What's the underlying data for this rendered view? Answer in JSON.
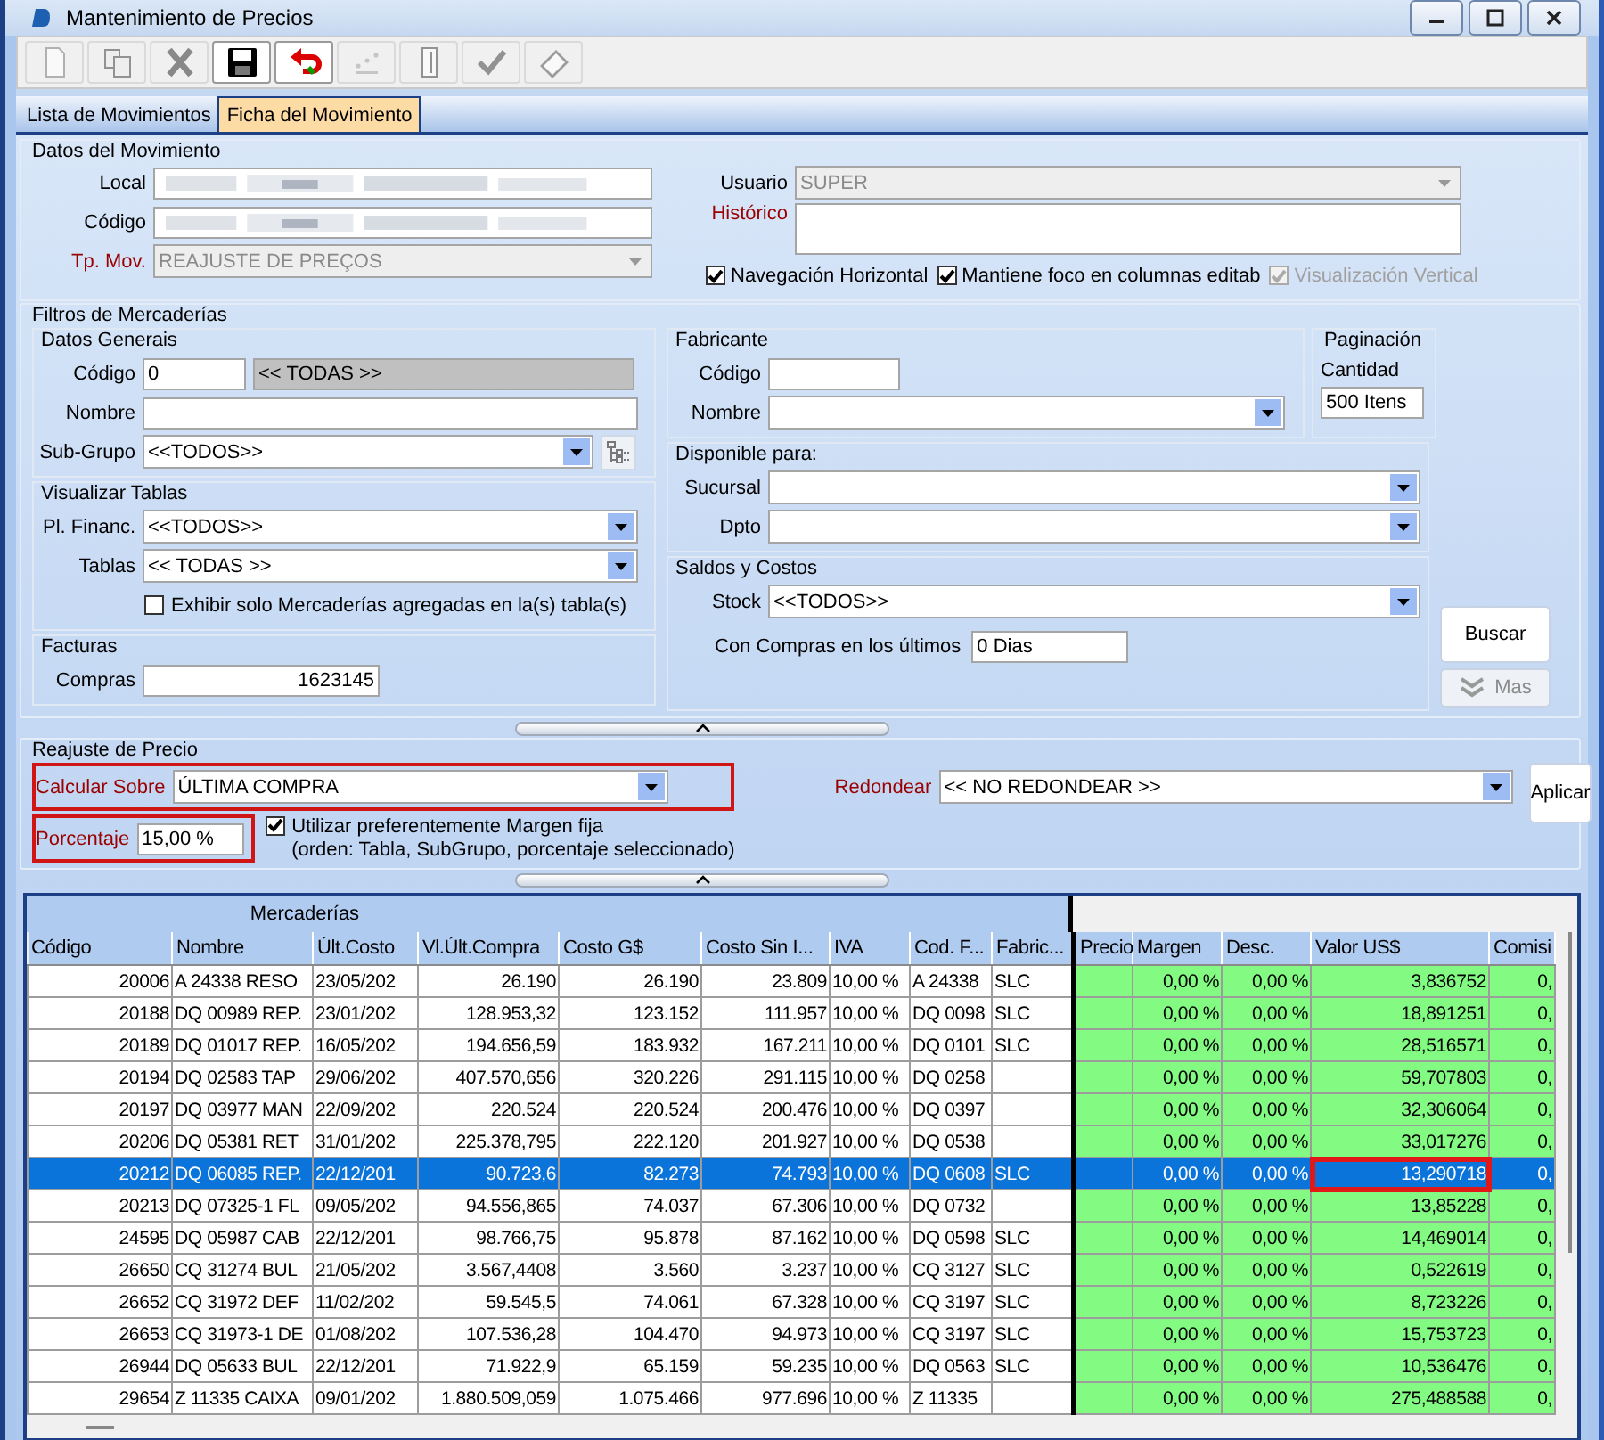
{
  "window": {
    "title": "Mantenimiento de Precios"
  },
  "toolbar": [
    {
      "disabled": true
    },
    {
      "disabled": true
    },
    {
      "disabled": true
    },
    {
      "disabled": false
    },
    {
      "disabled": false
    },
    {
      "disabled": true
    },
    {
      "disabled": true
    },
    {
      "disabled": true
    },
    {
      "disabled": true
    }
  ],
  "tabs": [
    {
      "label": "Lista de Movimientos",
      "selected": false
    },
    {
      "label": "Ficha del Movimiento",
      "selected": true
    }
  ],
  "movimiento": {
    "title": "Datos del Movimiento",
    "local": {
      "label": "Local",
      "required": false,
      "redacted": true
    },
    "codigo": {
      "label": "Código",
      "required": false,
      "redacted": true
    },
    "tp_mov": {
      "label": "Tp. Mov.",
      "value": "REAJUSTE DE PREÇOS",
      "required": true,
      "disabled": true
    },
    "usuario": {
      "label": "Usuario",
      "value": "SUPER",
      "required": false,
      "disabled": true
    },
    "historico": {
      "label": "Histórico",
      "required": true
    },
    "options": [
      {
        "label": "Navegación Horizontal",
        "checked": true,
        "disabled": false
      },
      {
        "label": "Mantiene foco en columnas editab",
        "checked": true,
        "disabled": false
      },
      {
        "label": "Visualización Vertical",
        "checked": true,
        "disabled": true
      }
    ]
  },
  "filtros": {
    "title": "Filtros de Mercaderías",
    "datos_generales": {
      "title": "Datos Generais",
      "codigo": {
        "label": "Código",
        "value": "0",
        "description": "<< TODAS >>"
      },
      "nombre": {
        "label": "Nombre"
      },
      "sub_grupo": {
        "label": "Sub-Grupo",
        "value": "<<TODOS>>"
      }
    },
    "visualizar_tablas": {
      "title": "Visualizar Tablas",
      "pl_financ": {
        "label": "Pl. Financ.",
        "value": "<<TODOS>>"
      },
      "tablas": {
        "label": "Tablas",
        "value": "<< TODAS >>"
      },
      "solo_agregadas": {
        "label": "Exhibir solo Mercaderías agregadas en la(s) tabla(s)",
        "checked": false
      }
    },
    "facturas": {
      "title": "Facturas",
      "compras": {
        "label": "Compras",
        "value": "1623145"
      }
    },
    "fabricante": {
      "title": "Fabricante",
      "codigo": {
        "label": "Código"
      },
      "nombre": {
        "label": "Nombre"
      }
    },
    "paginacion": {
      "title": "Paginación",
      "cantidad": {
        "label": "Cantidad",
        "value": "500 Itens"
      }
    },
    "disponible": {
      "title": "Disponible para:",
      "sucursal": {
        "label": "Sucursal"
      },
      "dpto": {
        "label": "Dpto"
      }
    },
    "saldos": {
      "title": "Saldos y Costos",
      "stock": {
        "label": "Stock",
        "value": "<<TODOS>>"
      },
      "con_compras": {
        "label": "Con Compras en los últimos",
        "value": "0 Dias"
      }
    },
    "buttons": [
      {
        "label": "Buscar",
        "disabled": false
      },
      {
        "label": "Mas",
        "disabled": true
      }
    ]
  },
  "reajuste": {
    "title": "Reajuste de Precio",
    "calcular_sobre": {
      "label": "Calcular Sobre",
      "value": "ÚLTIMA COMPRA",
      "required": true,
      "highlighted": true
    },
    "porcentaje": {
      "label": "Porcentaje",
      "value": "15,00 %",
      "required": true,
      "highlighted": true
    },
    "margen_fija": {
      "lines": [
        "Utilizar preferentemente Margen fija",
        "(orden: Tabla, SubGrupo, porcentaje seleccionado)"
      ],
      "checked": true
    },
    "redondear": {
      "label": "Redondear",
      "value": "<< NO REDONDEAR >>",
      "required": true,
      "highlighted": false
    },
    "aplicar": {
      "label": "Aplicar"
    }
  },
  "grid": {
    "title": "Mercaderías",
    "columns": [
      "Código",
      "Nombre",
      "Últ.Costo",
      "Vl.Últ.Compra",
      "Costo G$",
      "Costo Sin I...",
      "IVA",
      "Cod. F...",
      "Fabric...",
      "Precio",
      "Margen",
      "Desc.",
      "Valor US$",
      "Comisi"
    ],
    "rows": [
      {
        "codigo": "20006",
        "nombre": "A 24338 RESO",
        "ult_costo": "23/05/202",
        "vl_ult_compra": "26.190",
        "costo_gs": "26.190",
        "costo_sin_iva": "23.809",
        "iva": "10,00 %",
        "cod_fabricante": "A 24338",
        "fabricante": "SLC",
        "margen": "0,00 %",
        "desc": "0,00 %",
        "valor_us": "3,836752",
        "comision": "0,",
        "selected": false,
        "marked": false
      },
      {
        "codigo": "20188",
        "nombre": "DQ 00989 REP.",
        "ult_costo": "23/01/202",
        "vl_ult_compra": "128.953,32",
        "costo_gs": "123.152",
        "costo_sin_iva": "111.957",
        "iva": "10,00 %",
        "cod_fabricante": "DQ 0098",
        "fabricante": "SLC",
        "margen": "0,00 %",
        "desc": "0,00 %",
        "valor_us": "18,891251",
        "comision": "0,",
        "selected": false,
        "marked": false
      },
      {
        "codigo": "20189",
        "nombre": "DQ 01017 REP.",
        "ult_costo": "16/05/202",
        "vl_ult_compra": "194.656,59",
        "costo_gs": "183.932",
        "costo_sin_iva": "167.211",
        "iva": "10,00 %",
        "cod_fabricante": "DQ 0101",
        "fabricante": "SLC",
        "margen": "0,00 %",
        "desc": "0,00 %",
        "valor_us": "28,516571",
        "comision": "0,",
        "selected": false,
        "marked": false
      },
      {
        "codigo": "20194",
        "nombre": "DQ 02583 TAP",
        "ult_costo": "29/06/202",
        "vl_ult_compra": "407.570,656",
        "costo_gs": "320.226",
        "costo_sin_iva": "291.115",
        "iva": "10,00 %",
        "cod_fabricante": "DQ 0258",
        "margen": "0,00 %",
        "desc": "0,00 %",
        "valor_us": "59,707803",
        "comision": "0,",
        "selected": false,
        "marked": false
      },
      {
        "codigo": "20197",
        "nombre": "DQ 03977 MAN",
        "ult_costo": "22/09/202",
        "vl_ult_compra": "220.524",
        "costo_gs": "220.524",
        "costo_sin_iva": "200.476",
        "iva": "10,00 %",
        "cod_fabricante": "DQ 0397",
        "margen": "0,00 %",
        "desc": "0,00 %",
        "valor_us": "32,306064",
        "comision": "0,",
        "selected": false,
        "marked": false
      },
      {
        "codigo": "20206",
        "nombre": "DQ 05381 RET",
        "ult_costo": "31/01/202",
        "vl_ult_compra": "225.378,795",
        "costo_gs": "222.120",
        "costo_sin_iva": "201.927",
        "iva": "10,00 %",
        "cod_fabricante": "DQ 0538",
        "margen": "0,00 %",
        "desc": "0,00 %",
        "valor_us": "33,017276",
        "comision": "0,",
        "selected": false,
        "marked": false
      },
      {
        "codigo": "20212",
        "nombre": "DQ 06085 REP.",
        "ult_costo": "22/12/201",
        "vl_ult_compra": "90.723,6",
        "costo_gs": "82.273",
        "costo_sin_iva": "74.793",
        "iva": "10,00 %",
        "cod_fabricante": "DQ 0608",
        "fabricante": "SLC",
        "margen": "0,00 %",
        "desc": "0,00 %",
        "valor_us": "13,290718",
        "comision": "0,",
        "selected": true,
        "marked": true
      },
      {
        "codigo": "20213",
        "nombre": "DQ 07325-1 FL",
        "ult_costo": "09/05/202",
        "vl_ult_compra": "94.556,865",
        "costo_gs": "74.037",
        "costo_sin_iva": "67.306",
        "iva": "10,00 %",
        "cod_fabricante": "DQ 0732",
        "margen": "0,00 %",
        "desc": "0,00 %",
        "valor_us": "13,85228",
        "comision": "0,",
        "selected": false,
        "marked": false
      },
      {
        "codigo": "24595",
        "nombre": "DQ 05987 CAB",
        "ult_costo": "22/12/201",
        "vl_ult_compra": "98.766,75",
        "costo_gs": "95.878",
        "costo_sin_iva": "87.162",
        "iva": "10,00 %",
        "cod_fabricante": "DQ 0598",
        "fabricante": "SLC",
        "margen": "0,00 %",
        "desc": "0,00 %",
        "valor_us": "14,469014",
        "comision": "0,",
        "selected": false,
        "marked": false
      },
      {
        "codigo": "26650",
        "nombre": "CQ 31274 BUL",
        "ult_costo": "21/05/202",
        "vl_ult_compra": "3.567,4408",
        "costo_gs": "3.560",
        "costo_sin_iva": "3.237",
        "iva": "10,00 %",
        "cod_fabricante": "CQ 3127",
        "fabricante": "SLC",
        "margen": "0,00 %",
        "desc": "0,00 %",
        "valor_us": "0,522619",
        "comision": "0,",
        "selected": false,
        "marked": false
      },
      {
        "codigo": "26652",
        "nombre": "CQ 31972 DEF",
        "ult_costo": "11/02/202",
        "vl_ult_compra": "59.545,5",
        "costo_gs": "74.061",
        "costo_sin_iva": "67.328",
        "iva": "10,00 %",
        "cod_fabricante": "CQ 3197",
        "fabricante": "SLC",
        "margen": "0,00 %",
        "desc": "0,00 %",
        "valor_us": "8,723226",
        "comision": "0,",
        "selected": false,
        "marked": false
      },
      {
        "codigo": "26653",
        "nombre": "CQ 31973-1 DE",
        "ult_costo": "01/08/202",
        "vl_ult_compra": "107.536,28",
        "costo_gs": "104.470",
        "costo_sin_iva": "94.973",
        "iva": "10,00 %",
        "cod_fabricante": "CQ 3197",
        "fabricante": "SLC",
        "margen": "0,00 %",
        "desc": "0,00 %",
        "valor_us": "15,753723",
        "comision": "0,",
        "selected": false,
        "marked": false
      },
      {
        "codigo": "26944",
        "nombre": "DQ 05633 BUL",
        "ult_costo": "22/12/201",
        "vl_ult_compra": "71.922,9",
        "costo_gs": "65.159",
        "costo_sin_iva": "59.235",
        "iva": "10,00 %",
        "cod_fabricante": "DQ 0563",
        "fabricante": "SLC",
        "margen": "0,00 %",
        "desc": "0,00 %",
        "valor_us": "10,536476",
        "comision": "0,",
        "selected": false,
        "marked": false
      },
      {
        "codigo": "29654",
        "nombre": "Z 11335 CAIXA",
        "ult_costo": "09/01/202",
        "vl_ult_compra": "1.880.509,059",
        "costo_gs": "1.075.466",
        "costo_sin_iva": "977.696",
        "iva": "10,00 %",
        "cod_fabricante": "Z 11335",
        "margen": "0,00 %",
        "desc": "0,00 %",
        "valor_us": "275,488588",
        "comision": "0,",
        "selected": false,
        "marked": false
      }
    ]
  }
}
